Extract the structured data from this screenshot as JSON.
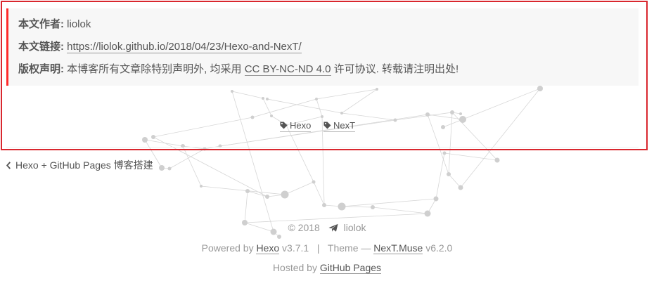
{
  "post_copyright": {
    "author_label": "本文作者:",
    "author_value": "liolok",
    "link_label": "本文链接:",
    "link_value": "https://liolok.github.io/2018/04/23/Hexo-and-NexT/",
    "license_label": "版权声明:",
    "license_pre": "本博客所有文章除特别声明外, 均采用",
    "license_link": "CC BY-NC-ND 4.0",
    "license_post": "许可协议. 转载请注明出处!"
  },
  "tags": [
    {
      "label": "Hexo",
      "icon": "tag-icon"
    },
    {
      "label": "NexT",
      "icon": "tag-icon"
    }
  ],
  "prev_post": {
    "label": "Hexo + GitHub Pages 博客搭建",
    "icon": "chevron-left-icon"
  },
  "footer": {
    "copyright": "© 2018",
    "author": "liolok",
    "author_icon": "paper-plane-icon",
    "powered_by": "Powered by",
    "hexo_link": "Hexo",
    "hexo_version": "v3.7.1",
    "separator": "|",
    "theme_label": "Theme —",
    "theme_link": "NexT.Muse",
    "theme_version": "v6.2.0",
    "hosted_by": "Hosted by",
    "hosted_link": "GitHub Pages"
  },
  "colors": {
    "highlight_border": "#d9272e",
    "copyright_accent": "#ff2a2a",
    "copyright_bg": "#f7f7f7",
    "text": "#555555",
    "muted_text": "#999999"
  }
}
